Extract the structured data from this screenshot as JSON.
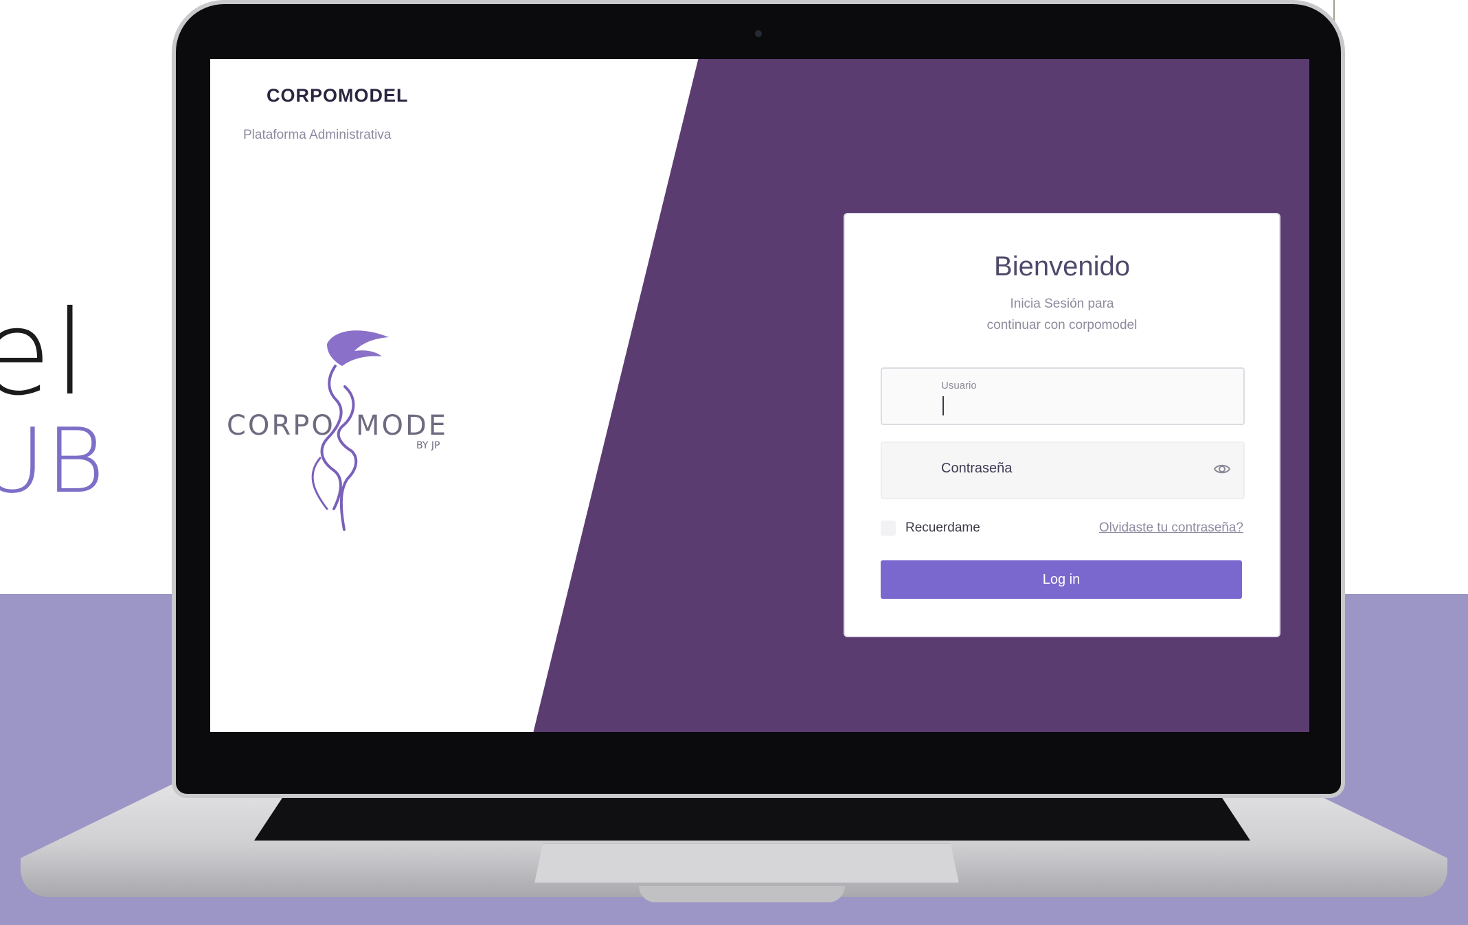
{
  "background": {
    "brand_line1": "el",
    "brand_line2": "UB"
  },
  "sidebar": {
    "title": "CORPOMODEL",
    "subtitle": "Plataforma Administrativa",
    "logo": {
      "left_text": "CORPO",
      "right_text": "MODEL",
      "tagline": "BY JP"
    }
  },
  "login": {
    "title": "Bienvenido",
    "subtitle_line1": "Inicia Sesión para",
    "subtitle_line2": "continuar con corpomodel",
    "username": {
      "label": "Usuario",
      "value": ""
    },
    "password": {
      "placeholder": "Contraseña",
      "icon": "eye-icon"
    },
    "remember_label": "Recuerdame",
    "forgot_link": "Olvidaste tu contraseña?",
    "submit_label": "Log in"
  },
  "colors": {
    "purple_panel": "#5b3c70",
    "accent": "#7b68ce",
    "lavender_bg": "#9c96c6"
  }
}
